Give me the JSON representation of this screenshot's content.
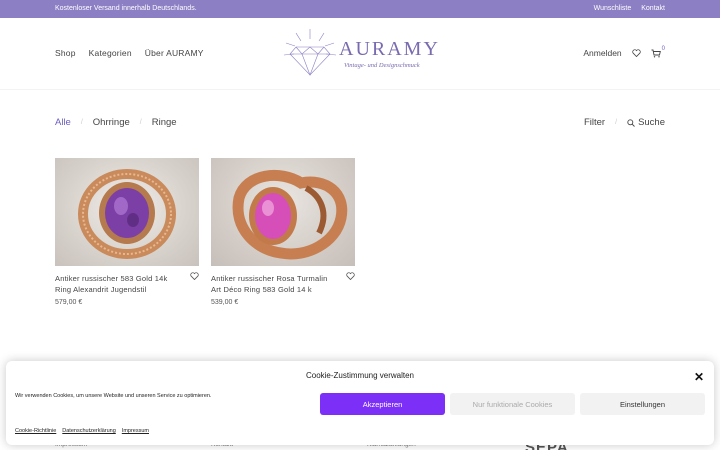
{
  "topbar": {
    "shipping": "Kostenloser Versand innerhalb Deutschlands.",
    "wishlist": "Wunschliste",
    "contact": "Kontakt"
  },
  "nav": {
    "items": [
      "Shop",
      "Kategorien",
      "Über AURAMY"
    ],
    "login": "Anmelden",
    "cart_count": "0"
  },
  "logo": {
    "name": "AURAMY",
    "tagline": "Vintage- und Designschmuck"
  },
  "filters": {
    "tabs": [
      "Alle",
      "Ohrringe",
      "Ringe"
    ],
    "filter_label": "Filter",
    "search_label": "Suche"
  },
  "products": [
    {
      "title": "Antiker russischer 583 Gold 14k Ring Alexandrit Jugendstil",
      "price": "579,00 €",
      "stone_color": "#7c3fa6"
    },
    {
      "title": "Antiker russischer Rosa Turmalin Art Déco Ring 583 Gold 14 k",
      "price": "539,00 €",
      "stone_color": "#d64fb8"
    }
  ],
  "footer": {
    "items": [
      "Impressum",
      "Kontakt",
      "Klarnazahlungen"
    ],
    "sepa": "SEPA"
  },
  "cookie": {
    "title": "Cookie-Zustimmung verwalten",
    "text": "Wir verwenden Cookies, um unsere Website und unseren Service zu optimieren.",
    "accept": "Akzeptieren",
    "functional": "Nur funktionale Cookies",
    "settings": "Einstellungen",
    "links": [
      "Cookie-Richtlinie",
      "Datenschutzerklärung",
      "Impressum"
    ]
  },
  "colors": {
    "accent": "#6a5fc1",
    "topbar": "#8c7fc4",
    "accept_button": "#7b2ff7"
  },
  "icons": [
    "search-icon",
    "heart-icon",
    "cart-icon",
    "close-icon",
    "diamond-logo-icon"
  ]
}
